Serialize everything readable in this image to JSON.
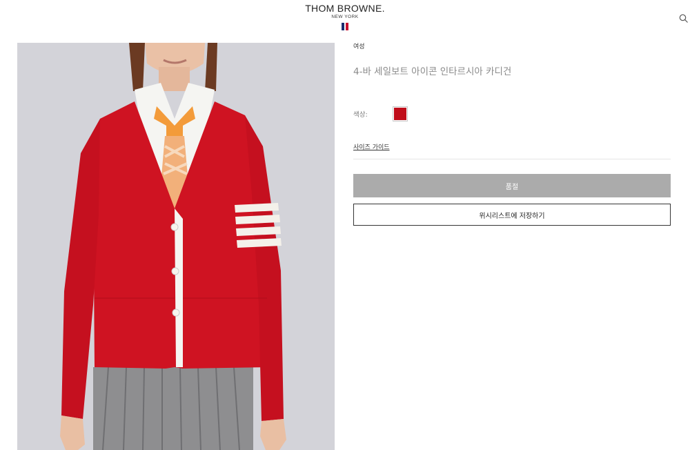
{
  "header": {
    "brand": "THOM BROWNE.",
    "brand_sub": "NEW YORK",
    "flag_colors": [
      "#1b2c6e",
      "#ffffff",
      "#c8102e"
    ],
    "search_icon": "search-icon"
  },
  "product": {
    "image_alt": "4-바 세일보트 아이콘 인타르시아 카디건",
    "category": "여성",
    "name": "4-바 세일보트 아이콘 인타르시아 카디건",
    "color_label": "색상:",
    "color_swatch": "#c00d1a",
    "size_guide": "사이즈 가이드",
    "soldout_label": "품절",
    "wishlist_label": "위시리스트에 저장하기"
  }
}
